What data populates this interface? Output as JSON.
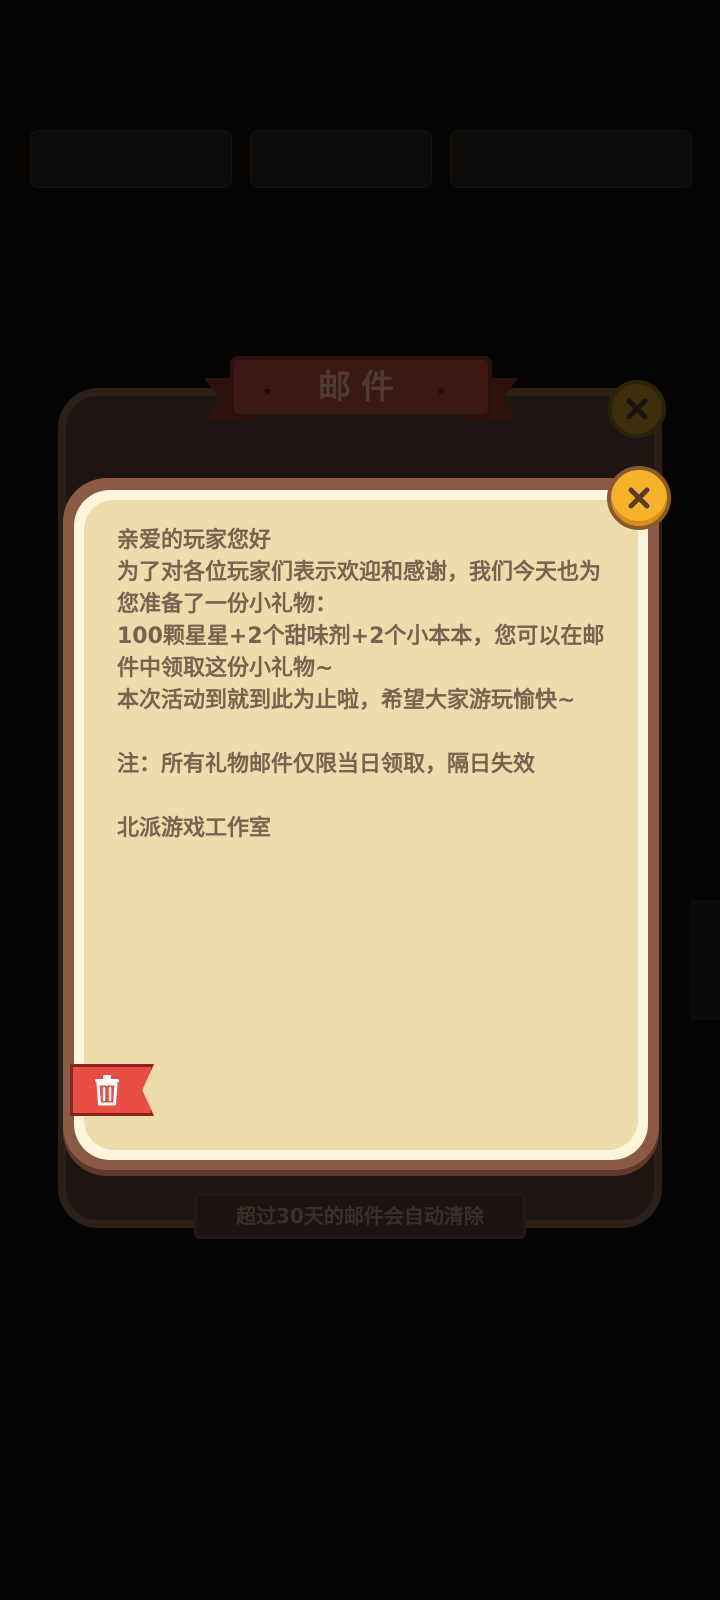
{
  "mail_panel": {
    "title": "邮件",
    "footer_note": "超过30天的邮件会自动清除"
  },
  "letter": {
    "paragraphs": [
      "亲爱的玩家您好",
      "为了对各位玩家们表示欢迎和感谢，我们今天也为您准备了一份小礼物：",
      "100颗星星+2个甜味剂+2个小本本，您可以在邮件中领取这份小礼物~",
      "本次活动到就到此为止啦，希望大家游玩愉快~"
    ],
    "note": "注：所有礼物邮件仅限当日领取，隔日失效",
    "signature": "北派游戏工作室"
  },
  "icons": {
    "close": "close-icon",
    "delete": "trash-icon"
  },
  "colors": {
    "paper": "#eedcac",
    "frame": "#8a5a44",
    "close_button": "#f5b32b",
    "delete_button": "#e74d43",
    "text": "#7b6150"
  }
}
